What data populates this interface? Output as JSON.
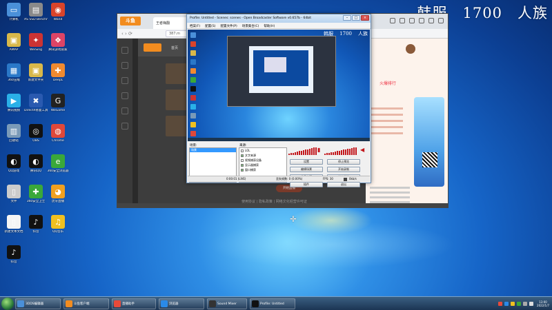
{
  "overlay": {
    "part1": "韩服",
    "part2": "1700",
    "part3": "人族"
  },
  "desktop_icons": [
    {
      "label": "计算机",
      "color": "#4a90d9",
      "glyph": "▭"
    },
    {
      "label": "AS SSD Benchmark",
      "color": "#8a8a8a",
      "glyph": "▤"
    },
    {
      "label": "Wand",
      "color": "#d9442a",
      "glyph": "◉"
    },
    {
      "label": "AMAP",
      "color": "#d8b84a",
      "glyph": "▣"
    },
    {
      "label": "WeiSing",
      "color": "#cc3333",
      "glyph": "✦"
    },
    {
      "label": "腾讯游戏管家",
      "color": "#dd4466",
      "glyph": "❖"
    },
    {
      "label": "360压缩",
      "color": "#2a78c8",
      "glyph": "▦"
    },
    {
      "label": "新建文件夹",
      "color": "#d8b84a",
      "glyph": "▣"
    },
    {
      "label": "DeepL",
      "color": "#f08a30",
      "glyph": "✚"
    },
    {
      "label": "腾讯视频",
      "color": "#2ab0e8",
      "glyph": "▶"
    },
    {
      "label": "DirectX修复工具",
      "color": "#2a5ab0",
      "glyph": "✖"
    },
    {
      "label": "WeGame",
      "color": "#222222",
      "glyph": "G"
    },
    {
      "label": "回收站",
      "color": "#7a9ab8",
      "glyph": "▥"
    },
    {
      "label": "OBS",
      "color": "#111111",
      "glyph": "◎"
    },
    {
      "label": "Chrome",
      "color": "#e0483a",
      "glyph": "◍"
    },
    {
      "label": "QQ游戏",
      "color": "#111111",
      "glyph": "◐"
    },
    {
      "label": "腾讯QQ",
      "color": "#111111",
      "glyph": "◐"
    },
    {
      "label": "360安全浏览器",
      "color": "#3aa83a",
      "glyph": "e"
    },
    {
      "label": "文件",
      "color": "#cccccc",
      "glyph": "▯"
    },
    {
      "label": "360安全卫士",
      "color": "#3aa83a",
      "glyph": "✚"
    },
    {
      "label": "虎牙直播",
      "color": "#f0a020",
      "glyph": "◕"
    },
    {
      "label": "新建文本文档",
      "color": "#f5f5f5",
      "glyph": "▯"
    },
    {
      "label": "抖音",
      "color": "#111111",
      "glyph": "♪"
    },
    {
      "label": "QQ音乐",
      "color": "#f0c020",
      "glyph": "♫"
    },
    {
      "label": "抖音",
      "color": "#111111",
      "glyph": "♪"
    }
  ],
  "browser": {
    "logo": "斗鱼",
    "tab_title": "王者嗨翻",
    "url": "387.m",
    "nav_home": "首页",
    "count": "12",
    "hot_label": "火爆排行",
    "bottom_pill": "开始直播",
    "footer_text": "使用协议 | 隐私政策 | 网络文化经营许可证"
  },
  "obs": {
    "title": "Profile: Untitled - Scenes: scenes - Open Broadcaster Software v0.657b - 64bit",
    "menu": [
      "档案(F)",
      "配置(S)",
      "配置文件(P)",
      "场景集合(C)",
      "帮助(H)"
    ],
    "preview_overlay": [
      "韩服",
      "1700",
      "人族"
    ],
    "scenes_label": "场景:",
    "sources_label": "来源:",
    "scenes": [
      "场景"
    ],
    "sources": [
      {
        "name": "LOL",
        "checked": false
      },
      {
        "name": "文字来源",
        "checked": true
      },
      {
        "name": "视频捕获设备",
        "checked": false
      },
      {
        "name": "显示器捕获",
        "checked": true
      },
      {
        "name": "窗口捕获",
        "checked": true
      }
    ],
    "buttons": {
      "settings": "设置",
      "stop_preview": "停止预览",
      "edit_scene": "编辑场景",
      "start_recording": "开始录制",
      "global_sources": "全局来源",
      "plugins": "插件管理",
      "plugins2": "插件",
      "exit": "退出"
    },
    "status": {
      "time": "0:00:01 (LIVE)",
      "dropped": "丢失帧数: 0 (0.00%)",
      "fps": "FPS: 30",
      "kbps": "0kb/s"
    }
  },
  "taskbar": {
    "items": [
      {
        "label": "3DDS编辑器",
        "color": "#4a90d9"
      },
      {
        "label": "斗鱼客户端",
        "color": "#f28c1f"
      },
      {
        "label": "直播助手",
        "color": "#e84a3a"
      },
      {
        "label": "浏览器",
        "color": "#2a8ae8"
      },
      {
        "label": "Sound Mixer",
        "color": "#333333"
      },
      {
        "label": "Profile: Untitled",
        "color": "#111111"
      }
    ],
    "clock_time": "13:00",
    "clock_date": "2022/1/7"
  }
}
